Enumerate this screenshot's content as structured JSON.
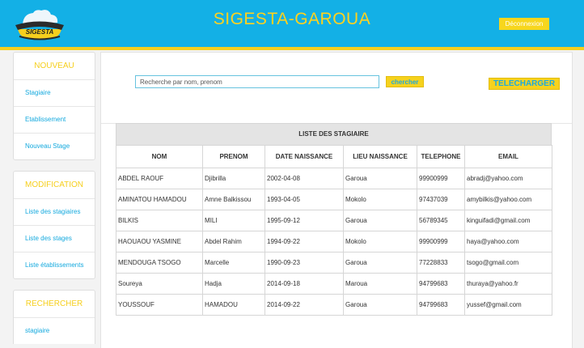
{
  "header": {
    "title": "SIGESTA-GAROUA",
    "logo_text": "SIGESTA",
    "logout_label": "Déconnexion",
    "colors": {
      "bar": "#13b0e6",
      "accent": "#f6cf1d"
    }
  },
  "sidebar": {
    "nouveau": {
      "title": "NOUVEAU",
      "items": [
        "Stagiaire",
        "Etablissement",
        "Nouveau Stage"
      ]
    },
    "modification": {
      "title": "MODIFICATION",
      "items": [
        "Liste des stagiaires",
        "Liste des stages",
        "Liste établissements"
      ]
    },
    "rechercher": {
      "title": "RECHERCHER",
      "items": [
        "stagiaire"
      ]
    }
  },
  "search": {
    "placeholder": "Recherche par nom, prenom",
    "button_label": "chercher"
  },
  "download_label": "TELECHARGER",
  "table": {
    "caption": "LISTE DES STAGIAIRE",
    "headers": [
      "NOM",
      "PRENOM",
      "DATE NAISSANCE",
      "LIEU NAISSANCE",
      "TELEPHONE",
      "EMAIL"
    ],
    "rows": [
      [
        "ABDEL RAOUF",
        "Djibrilla",
        "2002-04-08",
        "Garoua",
        "99900999",
        "abradj@yahoo.com"
      ],
      [
        "AMINATOU HAMADOU",
        "Amne Balkissou",
        "1993-04-05",
        "Mokolo",
        "97437039",
        "amybilkis@yahoo.com"
      ],
      [
        "BILKIS",
        "MILI",
        "1995-09-12",
        "Garoua",
        "56789345",
        "kinguifadi@gmail.com"
      ],
      [
        "HAOUAOU YASMINE",
        "Abdel Rahim",
        "1994-09-22",
        "Mokolo",
        "99900999",
        "haya@yahoo.com"
      ],
      [
        "MENDOUGA TSOGO",
        "Marcelle",
        "1990-09-23",
        "Garoua",
        "77228833",
        "tsogo@gmail.com"
      ],
      [
        "Soureya",
        "Hadja",
        "2014-09-18",
        "Maroua",
        "94799683",
        "thuraya@yahoo.fr"
      ],
      [
        "YOUSSOUF",
        "HAMADOU",
        "2014-09-22",
        "Garoua",
        "94799683",
        "yussef@gmail.com"
      ]
    ]
  }
}
